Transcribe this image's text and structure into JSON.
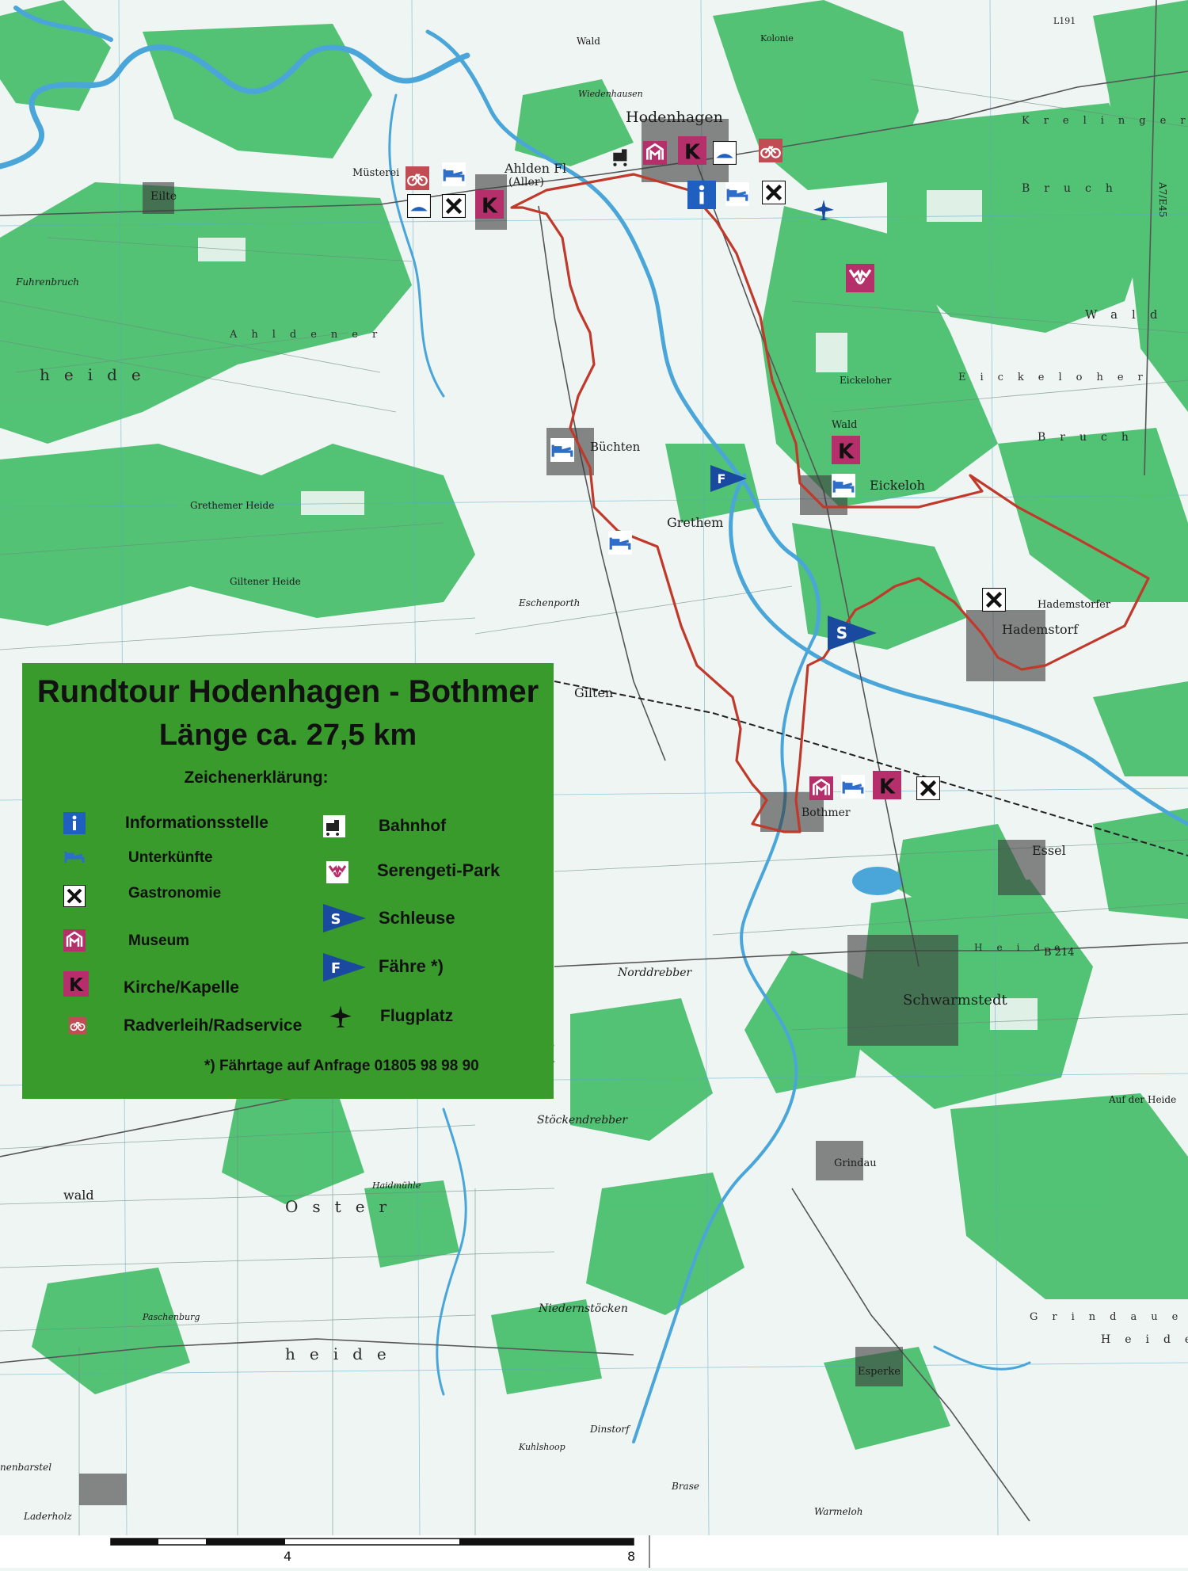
{
  "legend": {
    "title": "Rundtour Hodenhagen - Bothmer",
    "length": "Länge ca. 27,5 km",
    "heading": "Zeichenerklärung:",
    "items": [
      {
        "icon": "info-icon",
        "label": "Informationsstelle"
      },
      {
        "icon": "bed-icon",
        "label": "Unterkünfte"
      },
      {
        "icon": "gastronomy-icon",
        "label": "Gastronomie"
      },
      {
        "icon": "museum-icon",
        "label": "Museum"
      },
      {
        "icon": "church-icon",
        "label": "Kirche/Kapelle"
      },
      {
        "icon": "bicycle-icon",
        "label": "Radverleih/Radservice"
      },
      {
        "icon": "train-icon",
        "label": "Bahnhof"
      },
      {
        "icon": "serengeti-icon",
        "label": "Serengeti-Park"
      },
      {
        "icon": "lock-icon",
        "label": "Schleuse"
      },
      {
        "icon": "ferry-icon",
        "label": "Fähre *)"
      },
      {
        "icon": "airport-icon",
        "label": "Flugplatz"
      }
    ],
    "footnote": "*) Fährtage auf Anfrage 01805 98 98 90",
    "colors": {
      "background": "#3a9b2d",
      "text": "#111111"
    }
  },
  "route": {
    "color": "#c0392b"
  },
  "icon_colors": {
    "info": "#1f5fbf",
    "bed": "#2f6ec8",
    "museum": "#b5306a",
    "church": "#b5306a",
    "bicycle": "#b5306a",
    "serengeti": "#b5306a",
    "lock": "#1a4aa0",
    "ferry": "#1a4aa0",
    "airport": "#1a4aa0",
    "gastronomy": "#111111"
  },
  "places": {
    "hodenhagen": "Hodenhagen",
    "ahlden": "Ahlden Fl",
    "aller": "(Aller)",
    "eilte": "Eilte",
    "muesterei": "Müsterei",
    "buechten": "Büchten",
    "grethem": "Grethem",
    "eickeloh": "Eickeloh",
    "hademstorf": "Hademstorf",
    "hademstorfer": "Hademstorfer",
    "gilten": "Gilten",
    "bothmer": "Bothmer",
    "essel": "Essel",
    "schwarmstedt": "Schwarmstedt",
    "norddrebber": "Norddrebber",
    "stoeckendrebber": "Stöckendrebber",
    "grindau": "Grindau",
    "niedernstoecken": "Niedernstöcken",
    "esperke": "Esperke",
    "dinstorf": "Dinstorf",
    "brase": "Brase",
    "warmeloh": "Warmeloh",
    "paschenburg": "Paschenburg",
    "kuhlshoop": "Kuhlshoop",
    "haidmuehle": "Haidmühle",
    "laderholz": "Laderholz",
    "nenbarstel": "nenbarstel",
    "wald1": "Wald",
    "wald2": "Wald",
    "wald3": "wald",
    "wald4": "Wald",
    "bruch": "Bruch",
    "bruch2": "Bruch",
    "ostertext": "Oster",
    "heide1": "heide",
    "heide2": "heide",
    "heide3": "Heide",
    "heide4": "Heide",
    "krelinger": "Krelinger",
    "eickeloher": "Eickeloher",
    "eickeloher2": "Eickeloher",
    "grethemer_heide": "Grethemer Heide",
    "giltener_heide": "Giltener Heide",
    "grindauer": "Grindauer",
    "auf_der_heide": "Auf der Heide",
    "eschenporth": "Eschenporth",
    "ahldener": "Ahldener",
    "fuhrenbruch": "Fuhrenbruch",
    "kolonie": "Kolonie",
    "wiedenhausen": "Wiedenhausen",
    "b214": "B 214",
    "a7": "A7/E45",
    "l191": "L191"
  },
  "scale": {
    "ticks": [
      "4",
      "8"
    ]
  }
}
